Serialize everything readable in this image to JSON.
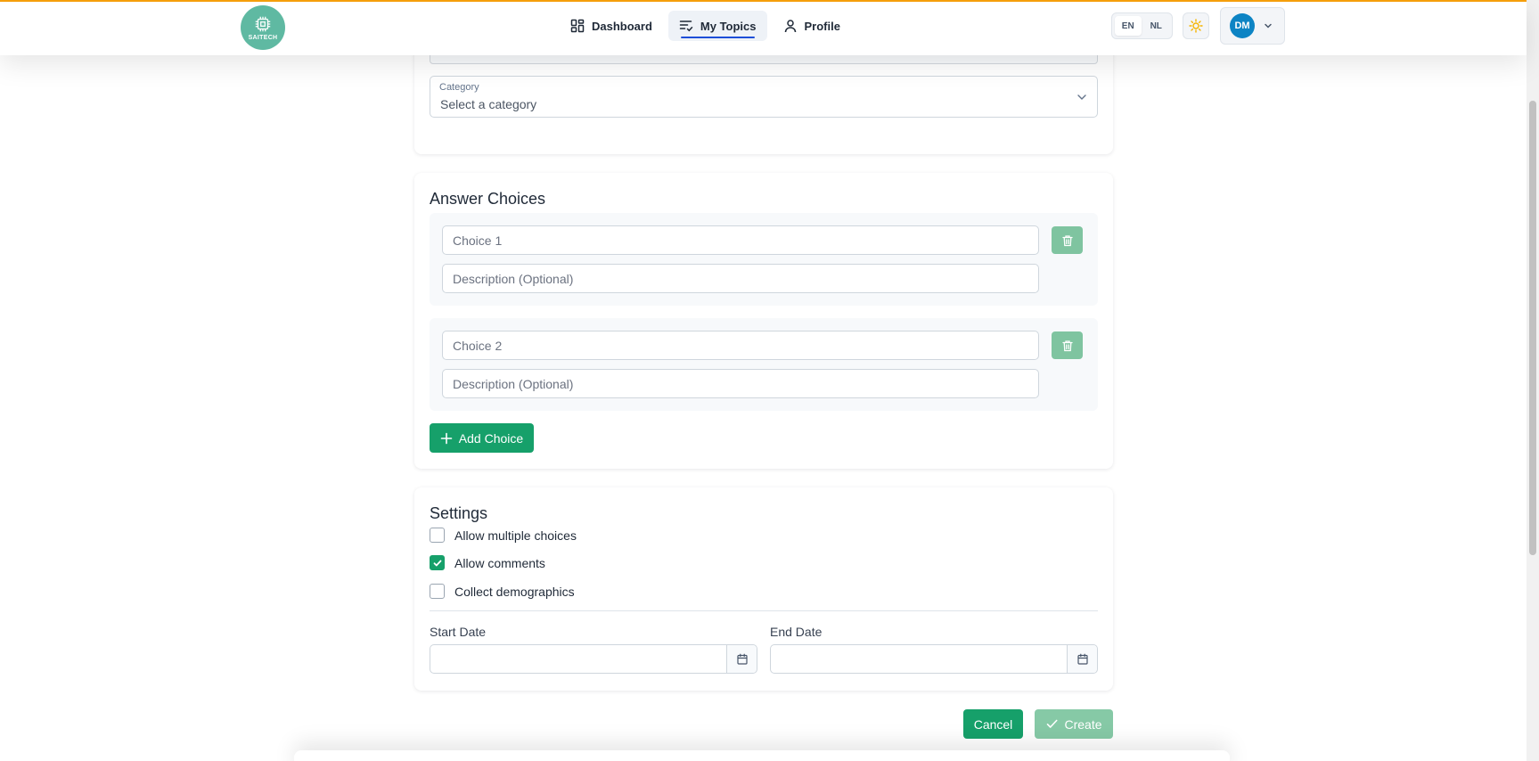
{
  "app": {
    "logo_text": "SAITECH"
  },
  "nav": {
    "items": [
      {
        "label": "Dashboard",
        "icon": "dashboard-icon"
      },
      {
        "label": "My Topics",
        "icon": "list-check-icon",
        "active": true
      },
      {
        "label": "Profile",
        "icon": "user-icon"
      }
    ]
  },
  "header": {
    "languages": [
      "EN",
      "NL"
    ],
    "active_language": "EN",
    "theme_icon": "sun-icon",
    "user_initials": "DM"
  },
  "category": {
    "label": "Category",
    "value": "Select a category"
  },
  "answer_choices": {
    "title": "Answer Choices",
    "choices": [
      {
        "placeholder": "Choice 1",
        "description_placeholder": "Description (Optional)"
      },
      {
        "placeholder": "Choice 2",
        "description_placeholder": "Description (Optional)"
      }
    ],
    "add_label": "Add Choice"
  },
  "settings": {
    "title": "Settings",
    "options": [
      {
        "label": "Allow multiple choices",
        "checked": false
      },
      {
        "label": "Allow comments",
        "checked": true
      },
      {
        "label": "Collect demographics",
        "checked": false
      }
    ],
    "start_date_label": "Start Date",
    "end_date_label": "End Date"
  },
  "actions": {
    "cancel_label": "Cancel",
    "create_label": "Create"
  },
  "colors": {
    "accent_top": "#f59e0b",
    "primary_green": "#16a06a",
    "disabled_green": "#86c9a6",
    "avatar_blue": "#0d84c4"
  }
}
